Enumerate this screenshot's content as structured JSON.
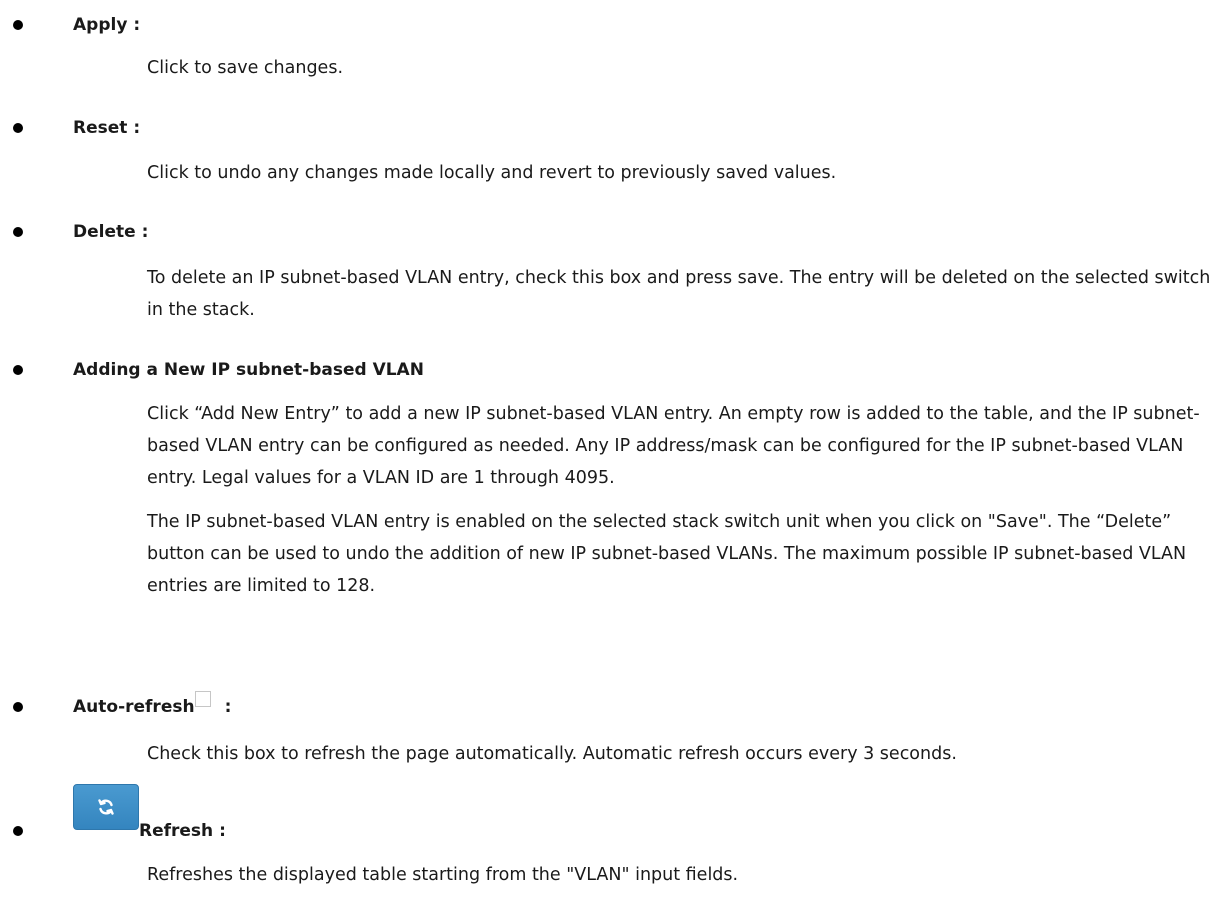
{
  "items": [
    {
      "heading": "Apply :",
      "description": [
        "Click to save changes."
      ]
    },
    {
      "heading": "Reset :",
      "description": [
        "Click to undo any changes made locally and revert to previously saved values."
      ]
    },
    {
      "heading": "Delete :",
      "description": [
        "To delete an IP subnet-based VLAN entry, check this box and press save. The entry will be deleted on the selected switch in the stack."
      ]
    },
    {
      "heading": "Adding a New IP subnet-based VLAN",
      "description": [
        "Click “Add New Entry” to add a new IP subnet-based VLAN entry. An empty row is added to the table, and the IP subnet-based VLAN entry can be configured as needed. Any IP address/mask can be configured for the IP subnet-based VLAN entry. Legal values for a VLAN ID are 1 through 4095.",
        "The IP subnet-based VLAN entry is enabled on the selected stack switch unit when you click on \"Save\". The “Delete” button can be used to undo the addition of new IP subnet-based VLANs. The maximum possible IP subnet-based VLAN entries are limited to 128."
      ]
    },
    {
      "heading": "Auto-refresh",
      "heading_suffix": ":",
      "description": [
        "Check this box to refresh the page automatically. Automatic refresh occurs every 3 seconds."
      ]
    },
    {
      "heading": "Refresh :",
      "description": [
        "Refreshes the displayed table starting from the \"VLAN\" input fields."
      ]
    }
  ],
  "icons": {
    "bullet": "filled-circle",
    "auto_refresh_checkbox": "checkbox-unchecked-icon",
    "refresh_button": "refresh-arrows-icon"
  },
  "colors": {
    "text": "#1a1a1a",
    "refresh_button_bg": "#3d8fc9",
    "checkbox_border": "#c6c6c6"
  }
}
